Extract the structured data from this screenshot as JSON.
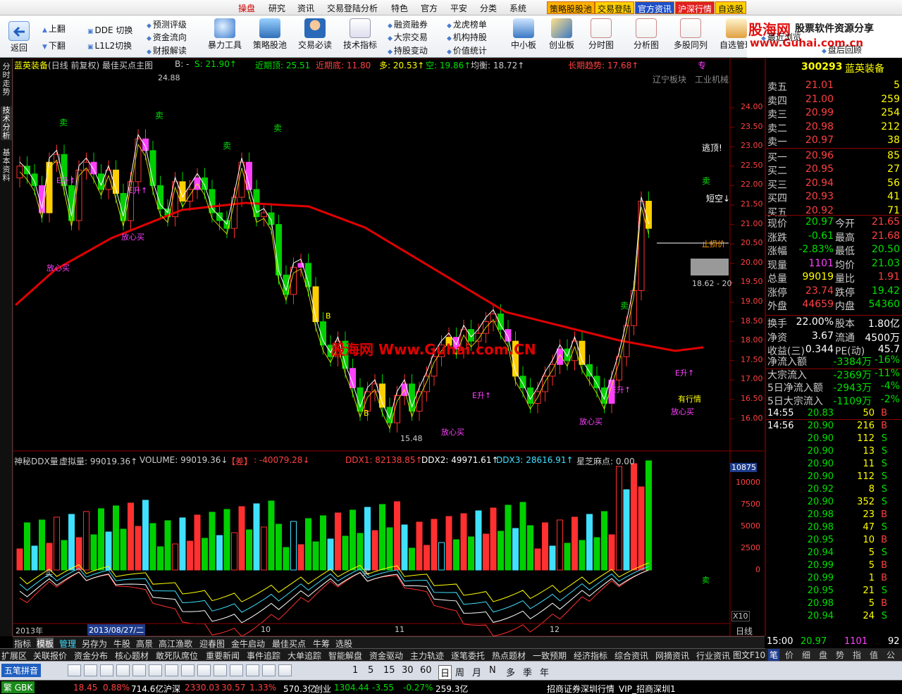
{
  "menu": {
    "items": [
      "操盘",
      "研究",
      "资讯",
      "交易登陆分析",
      "特色",
      "官方",
      "平安",
      "分类",
      "系统"
    ],
    "highlights": [
      "策略股股池",
      "交易登陆",
      "官方资讯",
      "沪深行情",
      "自选股"
    ]
  },
  "brand": {
    "title": "股海网",
    "tag": "股票软件资源分享",
    "url": "www.Guhai.com.cn"
  },
  "toolbar": {
    "back": "返回",
    "up": "上翻",
    "down": "下翻",
    "dde": "DDE 切换",
    "l2": "L1L2切换",
    "group1": [
      "预测评级",
      "资金流向",
      "财报解读"
    ],
    "big": [
      "暴力工具",
      "策略股池",
      "交易必读",
      "技术指标"
    ],
    "group2": [
      "融资融券",
      "大宗交易",
      "持股变动"
    ],
    "group3": [
      "龙虎榜单",
      "机构持股",
      "价值统计"
    ],
    "big2": [
      "中小板",
      "创业板",
      "分时图",
      "分析图",
      "多股同列",
      "自选管理"
    ],
    "group4": [
      "最近浏览",
      "盘后回顾"
    ]
  },
  "lefttabs": [
    "分时走势",
    "技术分析",
    "基本资料"
  ],
  "main": {
    "title": "蓝英装备",
    "title_sub": "(日线 前复权) 最佳买点主图",
    "b_label": "B: -",
    "s_label": "S: 21.90↑",
    "recent_high": "近期顶: 25.51",
    "recent_low": "近期底: 11.80",
    "long_label": "多: 20.53↑",
    "short_label": "空: 19.86↑",
    "avg_label": "均衡: 18.72↑",
    "trend_label": "长期趋势: 17.68↑",
    "pro": "专",
    "sector1": "辽宁板块",
    "sector2": "工业机械",
    "escape": "逃顶!",
    "empty": "短空↓",
    "watermark": "股海网 Www.Guhai.com.CN",
    "peak": "24.88",
    "trough": "15.48",
    "price_box": "18.62 - 20",
    "annot_sell": "卖",
    "annot_buy": "放心买",
    "annot_rise": "E升↑",
    "annot_up": "有行情",
    "annot_b": "B",
    "annot_stop": "止损价"
  },
  "price_axis": [
    "24.00",
    "23.50",
    "23.00",
    "22.50",
    "22.00",
    "21.50",
    "21.00",
    "20.50",
    "20.00",
    "19.50",
    "19.00",
    "18.50",
    "18.00",
    "17.50",
    "17.00",
    "16.50",
    "16.00"
  ],
  "sub": {
    "title": "神秘DDX量",
    "vvol": "虚拟量: 99019.36↑",
    "volume": "VOLUME: 99019.36↓",
    "tag": "【差】",
    "diff": ": -40079.28↓",
    "ddx1": "DDX1: 82138.85↑",
    "ddx2": "DDX2: 49971.61↑",
    "ddx3": "DDX3: 28616.91↑",
    "sesame": "星芝麻点: 0.00",
    "axis_top": "10875",
    "axis": [
      "10000",
      "7500",
      "5000",
      "2500",
      "0"
    ],
    "x10": "X10",
    "buy": "买",
    "sell": "卖"
  },
  "dateaxis": {
    "year": "2013年",
    "cursor": "2013/08/27/二",
    "m10": "10",
    "m11": "11",
    "m12": "12",
    "period": "日线"
  },
  "quote": {
    "code": "300293",
    "name": "蓝英装备",
    "asks": [
      {
        "label": "卖五",
        "price": "21.01",
        "vol": "5"
      },
      {
        "label": "卖四",
        "price": "21.00",
        "vol": "259"
      },
      {
        "label": "卖三",
        "price": "20.99",
        "vol": "254"
      },
      {
        "label": "卖二",
        "price": "20.98",
        "vol": "212"
      },
      {
        "label": "卖一",
        "price": "20.97",
        "vol": "38"
      }
    ],
    "bids": [
      {
        "label": "买一",
        "price": "20.96",
        "vol": "85"
      },
      {
        "label": "买二",
        "price": "20.95",
        "vol": "27"
      },
      {
        "label": "买三",
        "price": "20.94",
        "vol": "56"
      },
      {
        "label": "买四",
        "price": "20.93",
        "vol": "41"
      },
      {
        "label": "买五",
        "price": "20.92",
        "vol": "71"
      }
    ],
    "stats": [
      {
        "l1": "现价",
        "v1": "20.97",
        "c1": "g",
        "l2": "今开",
        "v2": "21.65",
        "c2": "r"
      },
      {
        "l1": "涨跌",
        "v1": "-0.61",
        "c1": "g",
        "l2": "最高",
        "v2": "21.68",
        "c2": "r"
      },
      {
        "l1": "涨幅",
        "v1": "-2.83%",
        "c1": "g",
        "l2": "最低",
        "v2": "20.50",
        "c2": "g"
      },
      {
        "l1": "现量",
        "v1": "1101",
        "c1": "m",
        "l2": "均价",
        "v2": "21.03",
        "c2": "g"
      },
      {
        "l1": "总量",
        "v1": "99019",
        "c1": "y",
        "l2": "量比",
        "v2": "1.91",
        "c2": "r"
      },
      {
        "l1": "涨停",
        "v1": "23.74",
        "c1": "r",
        "l2": "跌停",
        "v2": "19.42",
        "c2": "g"
      },
      {
        "l1": "外盘",
        "v1": "44659",
        "c1": "r",
        "l2": "内盘",
        "v2": "54360",
        "c2": "g"
      }
    ],
    "stats2": [
      {
        "l1": "换手",
        "v1": "22.00%",
        "c1": "w",
        "l2": "股本",
        "v2": "1.80亿",
        "c2": "w"
      },
      {
        "l1": "净资",
        "v1": "3.67",
        "c1": "w",
        "l2": "流通",
        "v2": "4500万",
        "c2": "w"
      },
      {
        "l1": "收益(三)",
        "v1": "0.344",
        "c1": "w",
        "l2": "PE(动)",
        "v2": "45.7",
        "c2": "w"
      }
    ],
    "flows": [
      {
        "l": "净流入额",
        "v": "-3384万",
        "p": "-16%"
      },
      {
        "l": "大宗流入",
        "v": "-2369万",
        "p": "-11%"
      },
      {
        "l": "5日净流入额",
        "v": "-2943万",
        "p": "-4%"
      },
      {
        "l": "5日大宗流入",
        "v": "-1109万",
        "p": "-2%"
      }
    ],
    "ticks": [
      {
        "t": "14:55",
        "p": "20.83",
        "v": "50",
        "d": "B"
      },
      {
        "t": "14:56",
        "p": "20.90",
        "v": "216",
        "d": "B"
      },
      {
        "t": "",
        "p": "20.90",
        "v": "112",
        "d": "S"
      },
      {
        "t": "",
        "p": "20.90",
        "v": "13",
        "d": "S"
      },
      {
        "t": "",
        "p": "20.90",
        "v": "11",
        "d": "S"
      },
      {
        "t": "",
        "p": "20.90",
        "v": "112",
        "d": "S"
      },
      {
        "t": "",
        "p": "20.92",
        "v": "8",
        "d": "S"
      },
      {
        "t": "",
        "p": "20.90",
        "v": "352",
        "d": "S"
      },
      {
        "t": "",
        "p": "20.98",
        "v": "23",
        "d": "B"
      },
      {
        "t": "",
        "p": "20.98",
        "v": "47",
        "d": "S"
      },
      {
        "t": "",
        "p": "20.95",
        "v": "10",
        "d": "B"
      },
      {
        "t": "",
        "p": "20.94",
        "v": "5",
        "d": "S"
      },
      {
        "t": "",
        "p": "20.99",
        "v": "5",
        "d": "B"
      },
      {
        "t": "",
        "p": "20.99",
        "v": "1",
        "d": "B"
      },
      {
        "t": "",
        "p": "20.95",
        "v": "21",
        "d": "S"
      },
      {
        "t": "",
        "p": "20.98",
        "v": "5",
        "d": "B"
      },
      {
        "t": "",
        "p": "20.94",
        "v": "24",
        "d": "S"
      }
    ],
    "last_tick": {
      "t": "15:00",
      "p": "20.97",
      "v": "1101",
      "n": "92"
    },
    "tabs": [
      "笔",
      "价",
      "细",
      "盘",
      "势",
      "指",
      "值",
      "公"
    ]
  },
  "tabbar1": [
    "指标",
    "模板",
    "管理",
    "另存为",
    "牛股",
    "高景",
    "高江渔歌",
    "迎春图",
    "金牛启动",
    "最佳买点",
    "牛筹",
    "选股"
  ],
  "tabbar2": [
    "扩展区",
    "关联报价",
    "资金分布",
    "核心题材",
    "敢死队席位",
    "重要新闻",
    "事件追踪",
    "大单追踪",
    "智能解盘",
    "资金驱动",
    "主力轨迹",
    "逐笔委托",
    "热点题材",
    "一致预期",
    "经济指标",
    "综合资讯",
    "网摘资讯",
    "行业资讯"
  ],
  "tabbar2_right": "图文F10",
  "ftoolbar": {
    "ime": "五笔拼音",
    "ime2": "繁 GBK",
    "periods": [
      "1",
      "5",
      "15",
      "30",
      "60",
      "日",
      "周",
      "月",
      "N",
      "多",
      "季",
      "年"
    ]
  },
  "status": {
    "s1": "18.45",
    "s2": "0.88%",
    "s3": "714.6亿",
    "sh": "沪深",
    "s4": "2330.03",
    "s5": "30.57",
    "s6": "1.33%",
    "s7": "570.3亿",
    "cy": "创业",
    "s8": "1304.44",
    "s9": "-3.55",
    "s10": "-0.27%",
    "s11": "259.3亿",
    "broker": "招商证券深圳行情",
    "vip": "VIP_招商深圳1"
  },
  "colors": {
    "up": "#ff3030",
    "down": "#00d000",
    "ma": "#e00000",
    "cyan": "#40e0ff"
  }
}
